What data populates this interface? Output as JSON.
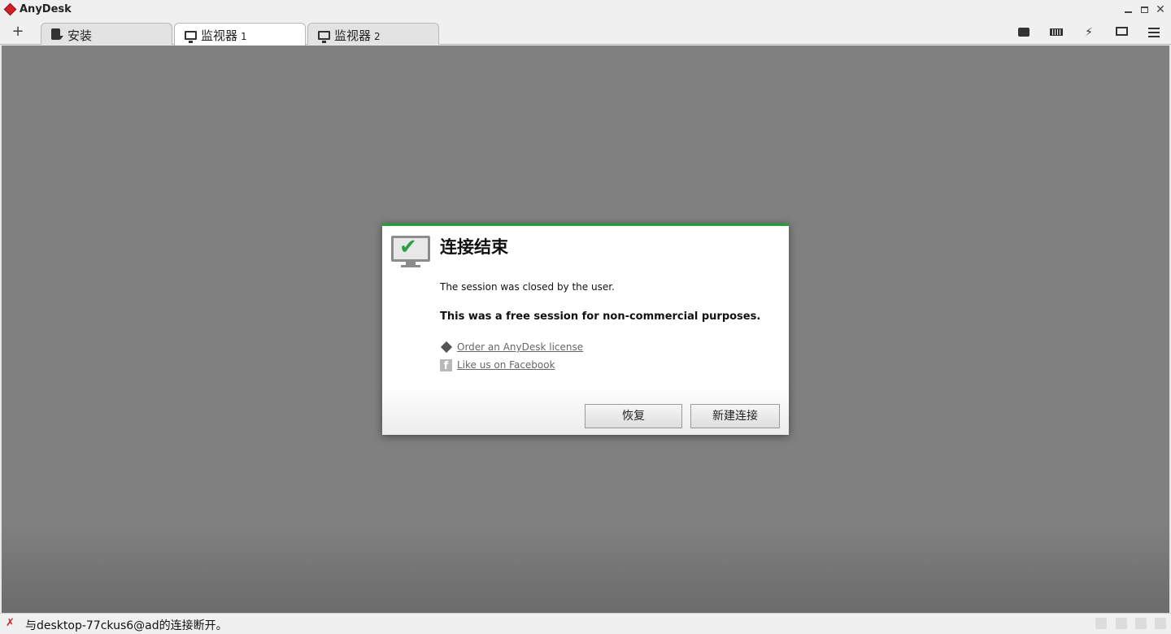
{
  "titlebar": {
    "app_title": "AnyDesk",
    "logo_color": "#d51f26"
  },
  "tabs": [
    {
      "label": "安装",
      "number": "",
      "icon": "install-icon"
    },
    {
      "label": "监视器",
      "number": "1",
      "icon": "monitor-icon",
      "active": true
    },
    {
      "label": "监视器",
      "number": "2",
      "icon": "monitor-icon"
    }
  ],
  "add_tab_label": "+",
  "toolbar_icons": [
    "chat-icon",
    "keyboard-icon",
    "actions-bolt-icon",
    "display-icon",
    "menu-icon"
  ],
  "dialog": {
    "title": "连接结束",
    "message": "The session was closed by the user.",
    "notice": "This was a free session for non-commercial purposes.",
    "link_license": "Order an AnyDesk license",
    "link_facebook": "Like us on Facebook",
    "button_restore": "恢复",
    "button_new": "新建连接",
    "accent_color": "#1f9e3a"
  },
  "statusbar": {
    "text": "与desktop-77ckus6@ad的连接断开。"
  },
  "colors": {
    "viewport_bg": "#808080",
    "chrome_bg": "#f0f0f0"
  }
}
